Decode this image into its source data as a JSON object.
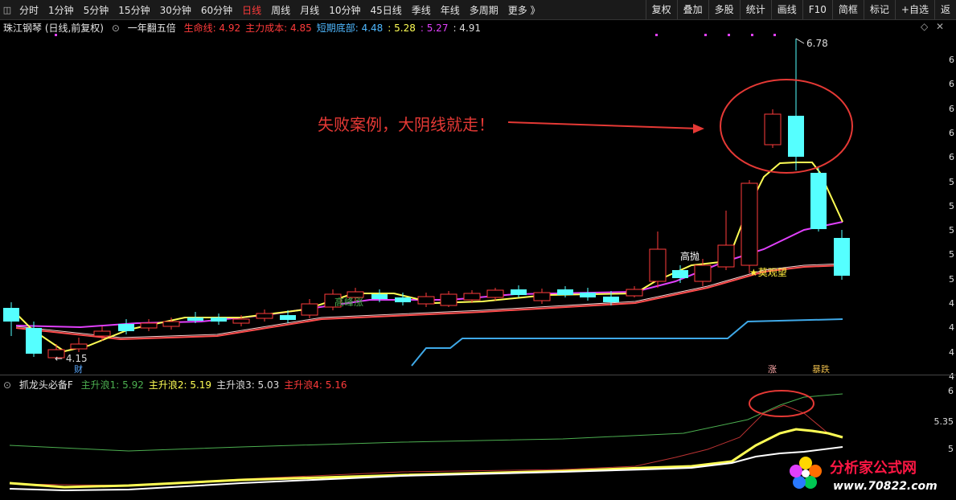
{
  "toolbar": {
    "left_icon": "sidebar-toggle-icon",
    "tabs": [
      "分时",
      "1分钟",
      "5分钟",
      "15分钟",
      "30分钟",
      "60分钟",
      "日线",
      "周线",
      "月线",
      "10分钟",
      "45日线",
      "季线",
      "年线",
      "多周期",
      "更多 》"
    ],
    "active_tab": "日线",
    "right_buttons": [
      "复权",
      "叠加",
      "多股",
      "统计",
      "画线",
      "F10",
      "简框",
      "标记",
      "+自选",
      "返"
    ]
  },
  "main_panel": {
    "stock": "珠江钢琴 (日线,前复权)",
    "indicator": "一年翻五倍",
    "items": [
      {
        "label": "生命线: 4.92",
        "color": "#ff3b3b"
      },
      {
        "label": "主力成本: 4.85",
        "color": "#ff3b3b"
      },
      {
        "label": "短期底部: 4.48",
        "color": "#4fb8ff"
      },
      {
        "label": ": 5.28",
        "color": "#ffff55"
      },
      {
        "label": ": 5.27",
        "color": "#e040fb"
      },
      {
        "label": ": 4.91",
        "color": "#dddddd"
      }
    ],
    "annotation": "失败案例，大阴线就走！",
    "high_label": "6.78",
    "low_label": "← 4.15",
    "tags": {
      "cai": "财",
      "zhang": "涨",
      "gaopao": "高抛",
      "moguanwang": "★莫观望",
      "gaofeng": "高峰涨",
      "ji_die": "暴跌"
    },
    "axis_labels": [
      "6",
      "6",
      "6",
      "6",
      "6",
      "5",
      "5",
      "5",
      "5",
      "5",
      "4",
      "4",
      "4",
      "4"
    ]
  },
  "sub_panel": {
    "indicator": "抓龙头必备F",
    "items": [
      {
        "label": "主升浪1: 5.92",
        "color": "#4caf50"
      },
      {
        "label": "主升浪2: 5.19",
        "color": "#ffff55"
      },
      {
        "label": "主升浪3: 5.03",
        "color": "#dddddd"
      },
      {
        "label": "主升浪4: 5.16",
        "color": "#ff3b3b"
      }
    ],
    "axis_labels": [
      "6",
      "5.35",
      "5"
    ]
  },
  "watermark": {
    "title": "分析家公式网",
    "url": "www.70822.com"
  },
  "colors": {
    "up": "#ff3b3b",
    "down": "#55ffff",
    "accent": "#ff3b3b"
  }
}
